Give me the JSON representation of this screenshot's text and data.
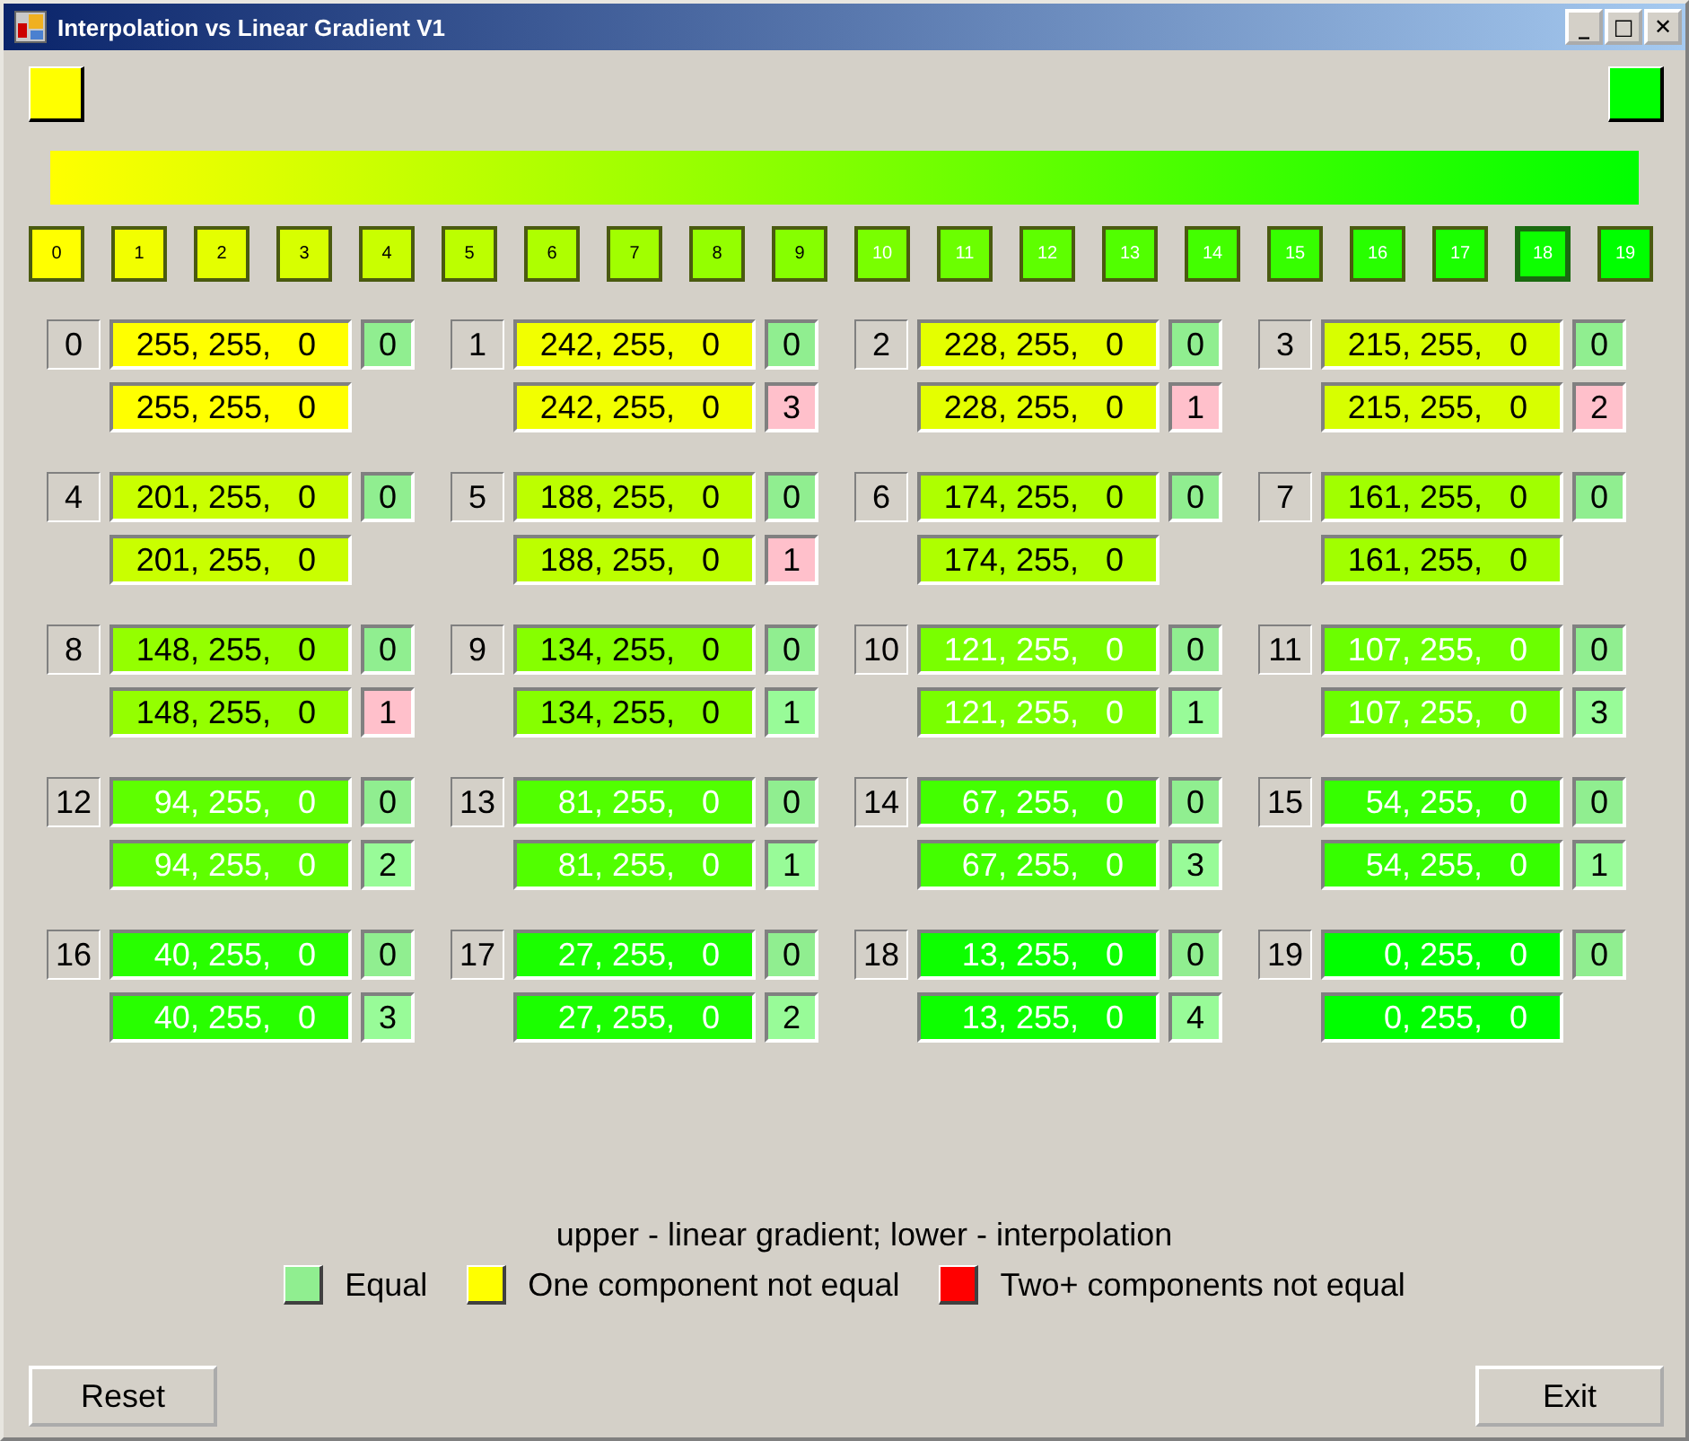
{
  "window": {
    "title": "Interpolation vs Linear Gradient V1",
    "controls": [
      "_",
      "□",
      "✕"
    ]
  },
  "gradient": {
    "start": {
      "color": "#ffff00"
    },
    "end": {
      "color": "#00ff00"
    }
  },
  "swatches": [
    {
      "label": "0",
      "color": "#ffff00",
      "selected": false
    },
    {
      "label": "1",
      "color": "#f2ff00",
      "selected": false
    },
    {
      "label": "2",
      "color": "#e4ff00",
      "selected": false
    },
    {
      "label": "3",
      "color": "#d7ff00",
      "selected": false
    },
    {
      "label": "4",
      "color": "#c9ff00",
      "selected": false
    },
    {
      "label": "5",
      "color": "#bcff00",
      "selected": false
    },
    {
      "label": "6",
      "color": "#aeff00",
      "selected": false
    },
    {
      "label": "7",
      "color": "#a1ff00",
      "selected": false
    },
    {
      "label": "8",
      "color": "#94ff00",
      "selected": false
    },
    {
      "label": "9",
      "color": "#86ff00",
      "selected": false
    },
    {
      "label": "10",
      "color": "#79ff00",
      "selected": false
    },
    {
      "label": "11",
      "color": "#6bff00",
      "selected": false
    },
    {
      "label": "12",
      "color": "#5eff00",
      "selected": false
    },
    {
      "label": "13",
      "color": "#51ff00",
      "selected": false
    },
    {
      "label": "14",
      "color": "#43ff00",
      "selected": false
    },
    {
      "label": "15",
      "color": "#36ff00",
      "selected": false
    },
    {
      "label": "16",
      "color": "#28ff00",
      "selected": false
    },
    {
      "label": "17",
      "color": "#1bff00",
      "selected": false
    },
    {
      "label": "18",
      "color": "#0dff00",
      "selected": true
    },
    {
      "label": "19",
      "color": "#00ff00",
      "selected": false
    }
  ],
  "items": [
    {
      "index": "0",
      "color": "#ffff00",
      "upper": "255, 255,   0",
      "upper_badge": {
        "text": "0",
        "color": "#90ee90"
      },
      "lower": "255, 255,   0"
    },
    {
      "index": "1",
      "color": "#f2ff00",
      "upper": "242, 255,   0",
      "upper_badge": {
        "text": "0",
        "color": "#90ee90"
      },
      "lower": "242, 255,   0",
      "lower_badge": {
        "text": "3",
        "color": "#ffc0cb"
      }
    },
    {
      "index": "2",
      "color": "#e4ff00",
      "upper": "228, 255,   0",
      "upper_badge": {
        "text": "0",
        "color": "#90ee90"
      },
      "lower": "228, 255,   0",
      "lower_badge": {
        "text": "1",
        "color": "#ffc0cb"
      }
    },
    {
      "index": "3",
      "color": "#d7ff00",
      "upper": "215, 255,   0",
      "upper_badge": {
        "text": "0",
        "color": "#90ee90"
      },
      "lower": "215, 255,   0",
      "lower_badge": {
        "text": "2",
        "color": "#ffc0cb"
      }
    },
    {
      "index": "4",
      "color": "#c9ff00",
      "upper": "201, 255,   0",
      "upper_badge": {
        "text": "0",
        "color": "#90ee90"
      },
      "lower": "201, 255,   0"
    },
    {
      "index": "5",
      "color": "#bcff00",
      "upper": "188, 255,   0",
      "upper_badge": {
        "text": "0",
        "color": "#90ee90"
      },
      "lower": "188, 255,   0",
      "lower_badge": {
        "text": "1",
        "color": "#ffc0cb"
      }
    },
    {
      "index": "6",
      "color": "#aeff00",
      "upper": "174, 255,   0",
      "upper_badge": {
        "text": "0",
        "color": "#90ee90"
      },
      "lower": "174, 255,   0"
    },
    {
      "index": "7",
      "color": "#a1ff00",
      "upper": "161, 255,   0",
      "upper_badge": {
        "text": "0",
        "color": "#90ee90"
      },
      "lower": "161, 255,   0"
    },
    {
      "index": "8",
      "color": "#94ff00",
      "upper": "148, 255,   0",
      "upper_badge": {
        "text": "0",
        "color": "#90ee90"
      },
      "lower": "148, 255,   0",
      "lower_badge": {
        "text": "1",
        "color": "#ffc0cb"
      }
    },
    {
      "index": "9",
      "color": "#86ff00",
      "upper": "134, 255,   0",
      "upper_badge": {
        "text": "0",
        "color": "#90ee90"
      },
      "lower": "134, 255,   0",
      "lower_badge": {
        "text": "1",
        "color": "#98fb98"
      }
    },
    {
      "index": "10",
      "color": "#79ff00",
      "upper": "121, 255,   0",
      "upper_badge": {
        "text": "0",
        "color": "#90ee90"
      },
      "lower": "121, 255,   0",
      "lower_badge": {
        "text": "1",
        "color": "#98fb98"
      }
    },
    {
      "index": "11",
      "color": "#6bff00",
      "upper": "107, 255,   0",
      "upper_badge": {
        "text": "0",
        "color": "#90ee90"
      },
      "lower": "107, 255,   0",
      "lower_badge": {
        "text": "3",
        "color": "#98fb98"
      }
    },
    {
      "index": "12",
      "color": "#5eff00",
      "upper": "94, 255,   0",
      "upper_badge": {
        "text": "0",
        "color": "#90ee90"
      },
      "lower": "94, 255,   0",
      "lower_badge": {
        "text": "2",
        "color": "#98fb98"
      }
    },
    {
      "index": "13",
      "color": "#51ff00",
      "upper": "81, 255,   0",
      "upper_badge": {
        "text": "0",
        "color": "#90ee90"
      },
      "lower": "81, 255,   0",
      "lower_badge": {
        "text": "1",
        "color": "#98fb98"
      }
    },
    {
      "index": "14",
      "color": "#43ff00",
      "upper": "67, 255,   0",
      "upper_badge": {
        "text": "0",
        "color": "#90ee90"
      },
      "lower": "67, 255,   0",
      "lower_badge": {
        "text": "3",
        "color": "#98fb98"
      }
    },
    {
      "index": "15",
      "color": "#36ff00",
      "upper": "54, 255,   0",
      "upper_badge": {
        "text": "0",
        "color": "#90ee90"
      },
      "lower": "54, 255,   0",
      "lower_badge": {
        "text": "1",
        "color": "#98fb98"
      }
    },
    {
      "index": "16",
      "color": "#28ff00",
      "upper": "40, 255,   0",
      "upper_badge": {
        "text": "0",
        "color": "#90ee90"
      },
      "lower": "40, 255,   0",
      "lower_badge": {
        "text": "3",
        "color": "#98fb98"
      }
    },
    {
      "index": "17",
      "color": "#1bff00",
      "upper": "27, 255,   0",
      "upper_badge": {
        "text": "0",
        "color": "#90ee90"
      },
      "lower": "27, 255,   0",
      "lower_badge": {
        "text": "2",
        "color": "#98fb98"
      }
    },
    {
      "index": "18",
      "color": "#0dff00",
      "upper": "13, 255,   0",
      "upper_badge": {
        "text": "0",
        "color": "#90ee90"
      },
      "lower": "13, 255,   0",
      "lower_badge": {
        "text": "4",
        "color": "#98fb98"
      }
    },
    {
      "index": "19",
      "color": "#00ff00",
      "upper": "0, 255,   0",
      "upper_badge": {
        "text": "0",
        "color": "#90ee90"
      },
      "lower": "0, 255,   0"
    }
  ],
  "caption": "upper - linear gradient; lower - interpolation",
  "legend": [
    {
      "label": "Equal",
      "color": "#90ee90"
    },
    {
      "label": "One component not equal",
      "color": "#ffff00"
    },
    {
      "label": "Two+ components not equal",
      "color": "#ff0000"
    }
  ],
  "buttons": [
    {
      "label": "Reset"
    },
    {
      "label": "Exit"
    }
  ]
}
